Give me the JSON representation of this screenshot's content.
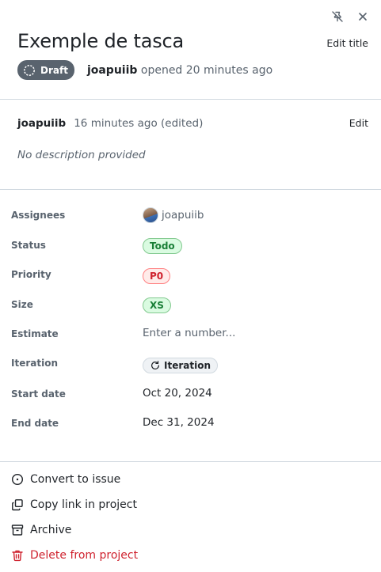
{
  "header": {
    "title": "Exemple de tasca",
    "edit_title_label": "Edit title",
    "icons": {
      "unpin": "pin-slash-icon",
      "close": "close-icon"
    }
  },
  "meta": {
    "badge_label": "Draft",
    "author": "joapuiib",
    "opened_text": "opened 20 minutes ago"
  },
  "comment": {
    "author": "joapuiib",
    "timestamp": "16 minutes ago (edited)",
    "edit_label": "Edit",
    "body": "No description provided"
  },
  "fields": {
    "assignees": {
      "label": "Assignees",
      "value": "joapuiib"
    },
    "status": {
      "label": "Status",
      "value": "Todo"
    },
    "priority": {
      "label": "Priority",
      "value": "P0"
    },
    "size": {
      "label": "Size",
      "value": "XS"
    },
    "estimate": {
      "label": "Estimate",
      "placeholder": "Enter a number..."
    },
    "iteration": {
      "label": "Iteration",
      "value": "Iteration"
    },
    "start_date": {
      "label": "Start date",
      "value": "Oct 20, 2024"
    },
    "end_date": {
      "label": "End date",
      "value": "Dec 31, 2024"
    }
  },
  "actions": {
    "convert": "Convert to issue",
    "copy_link": "Copy link in project",
    "archive": "Archive",
    "delete": "Delete from project"
  },
  "colors": {
    "danger": "#cf222e",
    "success": "#1a7f37",
    "muted": "#59636e",
    "draft_badge": "#59636e"
  }
}
